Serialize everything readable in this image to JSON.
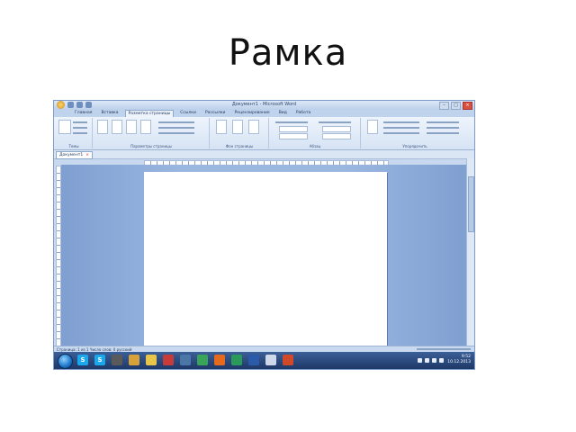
{
  "slide": {
    "title": "Рамка"
  },
  "window": {
    "title": "Документ1 - Microsoft Word",
    "controls": {
      "minimize": "–",
      "maximize": "□",
      "close": "×"
    }
  },
  "ribbon": {
    "tabs": [
      "Главная",
      "Вставка",
      "Разметка страницы",
      "Ссылки",
      "Рассылки",
      "Рецензирование",
      "Вид",
      "Работа"
    ],
    "active_tab": "Разметка страницы",
    "groups": [
      "Темы",
      "Параметры страницы",
      "Фон страницы",
      "Абзац",
      "Упорядочить"
    ]
  },
  "document_tab": {
    "label": "Документ1",
    "close": "×"
  },
  "statusbar": {
    "text": "Страница: 1 из 1   Число слов: 0   русский"
  },
  "taskbar": {
    "tasks": [
      {
        "name": "skype-icon",
        "glyph": "S",
        "color": "#1aa7ec"
      },
      {
        "name": "skype-icon-2",
        "glyph": "S",
        "color": "#1aa7ec"
      },
      {
        "name": "figure-icon",
        "glyph": "",
        "color": "#5a5a5a"
      },
      {
        "name": "app-icon",
        "glyph": "",
        "color": "#d8a23a"
      },
      {
        "name": "folder-icon",
        "glyph": "",
        "color": "#e8c64a"
      },
      {
        "name": "flag-icon",
        "glyph": "",
        "color": "#c83b3b"
      },
      {
        "name": "vk-icon",
        "glyph": "",
        "color": "#4a76a8"
      },
      {
        "name": "chrome-icon",
        "glyph": "",
        "color": "#3aa55a"
      },
      {
        "name": "firefox-icon",
        "glyph": "",
        "color": "#e66a1e"
      },
      {
        "name": "media-icon",
        "glyph": "",
        "color": "#2a9a5a"
      },
      {
        "name": "word-icon",
        "glyph": "",
        "color": "#2a5aa8"
      },
      {
        "name": "explorer-icon",
        "glyph": "",
        "color": "#cfd8e8"
      },
      {
        "name": "powerpoint-icon",
        "glyph": "",
        "color": "#d04a2a"
      }
    ],
    "clock_time": "9:52",
    "clock_date": "10.12.2013"
  }
}
